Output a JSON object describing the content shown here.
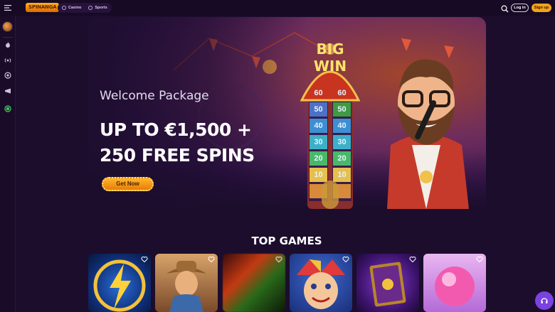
{
  "header": {
    "logo_text": "SPINANGA",
    "nav": [
      {
        "label": "Casino",
        "icon": "cards-icon"
      },
      {
        "label": "Sports",
        "icon": "ball-icon"
      }
    ],
    "login_label": "Log in",
    "signup_label": "Sign up"
  },
  "sidebar": {
    "items": [
      "avatar-icon",
      "flame-icon",
      "live-icon",
      "chip-icon",
      "promo-icon",
      "green-icon"
    ]
  },
  "hero": {
    "subtitle": "Welcome Package",
    "headline_line1": "UP TO €1,500 +",
    "headline_line2": "250 FREE SPINS",
    "cta_label": "Get Now",
    "sign_line1": "BIG",
    "sign_line2": "WIN",
    "tower_values_left": [
      "60",
      "50",
      "40",
      "30",
      "20",
      "10"
    ],
    "tower_values_right": [
      "60",
      "50",
      "40",
      "30",
      "20",
      "10"
    ]
  },
  "section": {
    "title": "TOP GAMES"
  },
  "games": [
    "lightning-game",
    "cowboy-game",
    "blurred-game",
    "joker-game",
    "book-game",
    "candy-game"
  ],
  "colors": {
    "accent": "#f4a21a",
    "background": "#1c0d2c",
    "help": "#7a42e0"
  }
}
